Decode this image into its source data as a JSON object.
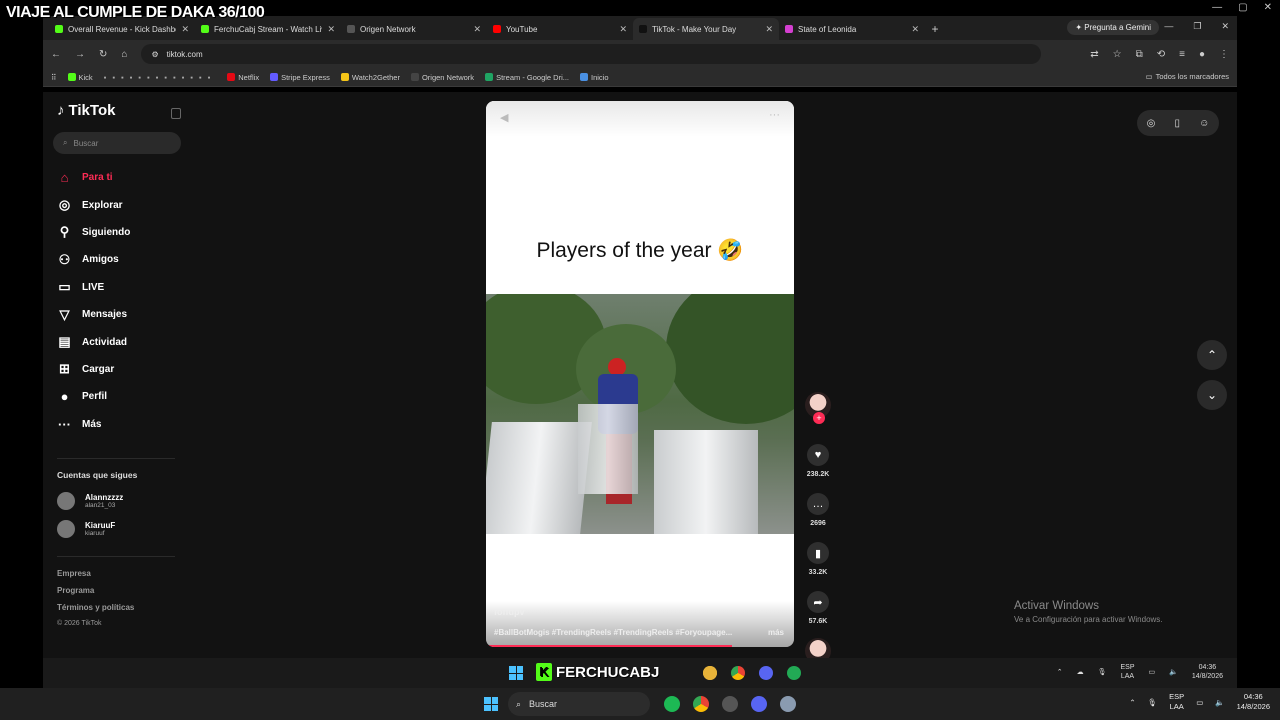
{
  "overlay": {
    "title": "VIAJE AL CUMPLE DE DAKA 36/100"
  },
  "browser": {
    "tabs": [
      {
        "title": "Overall Revenue - Kick Dashbo",
        "color": "#53fc18",
        "active": false
      },
      {
        "title": "FerchuCabj Stream - Watch Live",
        "color": "#53fc18",
        "active": false
      },
      {
        "title": "Origen Network",
        "color": "#555555",
        "active": false
      },
      {
        "title": "YouTube",
        "color": "#ff0000",
        "active": false
      },
      {
        "title": "TikTok - Make Your Day",
        "color": "#111111",
        "active": true
      },
      {
        "title": "State of Leonida",
        "color": "#d43fd0",
        "active": false
      }
    ],
    "gemini_label": "Pregunta a Gemini",
    "url": "tiktok.com",
    "bookmarks": [
      {
        "label": "Kick",
        "color": "#53fc18"
      },
      {
        "label": "Netflix",
        "color": "#e50914"
      },
      {
        "label": "Stripe Express",
        "color": "#635bff"
      },
      {
        "label": "Watch2Gether",
        "color": "#f5c518"
      },
      {
        "label": "Origen Network",
        "color": "#444444"
      },
      {
        "label": "Stream - Google Dri...",
        "color": "#1fa463"
      },
      {
        "label": "Inicio",
        "color": "#4a90e2"
      }
    ],
    "all_bookmarks": "Todos los marcadores"
  },
  "tiktok": {
    "logo": "TikTok",
    "search_placeholder": "Buscar",
    "nav": [
      {
        "label": "Para ti",
        "icon": "home-icon",
        "glyph": "⌂",
        "active": true
      },
      {
        "label": "Explorar",
        "icon": "compass-icon",
        "glyph": "◎",
        "active": false
      },
      {
        "label": "Siguiendo",
        "icon": "following-icon",
        "glyph": "⚲",
        "active": false
      },
      {
        "label": "Amigos",
        "icon": "friends-icon",
        "glyph": "⚇",
        "active": false
      },
      {
        "label": "LIVE",
        "icon": "live-icon",
        "glyph": "▭",
        "active": false
      },
      {
        "label": "Mensajes",
        "icon": "messages-icon",
        "glyph": "▽",
        "active": false
      },
      {
        "label": "Actividad",
        "icon": "activity-icon",
        "glyph": "▤",
        "active": false
      },
      {
        "label": "Cargar",
        "icon": "upload-icon",
        "glyph": "⊞",
        "active": false
      },
      {
        "label": "Perfil",
        "icon": "profile-icon",
        "glyph": "●",
        "active": false
      },
      {
        "label": "Más",
        "icon": "more-icon",
        "glyph": "···",
        "active": false
      }
    ],
    "following_header": "Cuentas que sigues",
    "accounts": [
      {
        "name": "Alannzzzz",
        "handle": "alan21_03"
      },
      {
        "name": "KiaruuF",
        "handle": "kiaruuf"
      }
    ],
    "footer": {
      "links": [
        "Empresa",
        "Programa",
        "Términos y políticas"
      ],
      "copyright": "© 2026 TikTok"
    },
    "video": {
      "caption": "Players of the year 🤣",
      "author": "foffdpv",
      "hashtags": "#BallBotMogis #TrendingReels #TrendingReels #Foryoupage...",
      "more": "más",
      "progress": 0.8
    },
    "actions": {
      "likes": "238.2K",
      "comments": "2696",
      "saves": "33.2K",
      "shares": "57.6K"
    },
    "activate_windows": {
      "title": "Activar Windows",
      "subtitle": "Ve a Configuración para activar Windows."
    }
  },
  "stream_taskbar": {
    "brand": "FERCHUCABJ",
    "lang": "ESP",
    "layout": "LAA",
    "time": "04:36",
    "date": "14/8/2026"
  },
  "taskbar": {
    "search_placeholder": "Buscar",
    "lang": "ESP",
    "layout": "LAA",
    "time": "04:36",
    "date": "14/8/2026"
  }
}
